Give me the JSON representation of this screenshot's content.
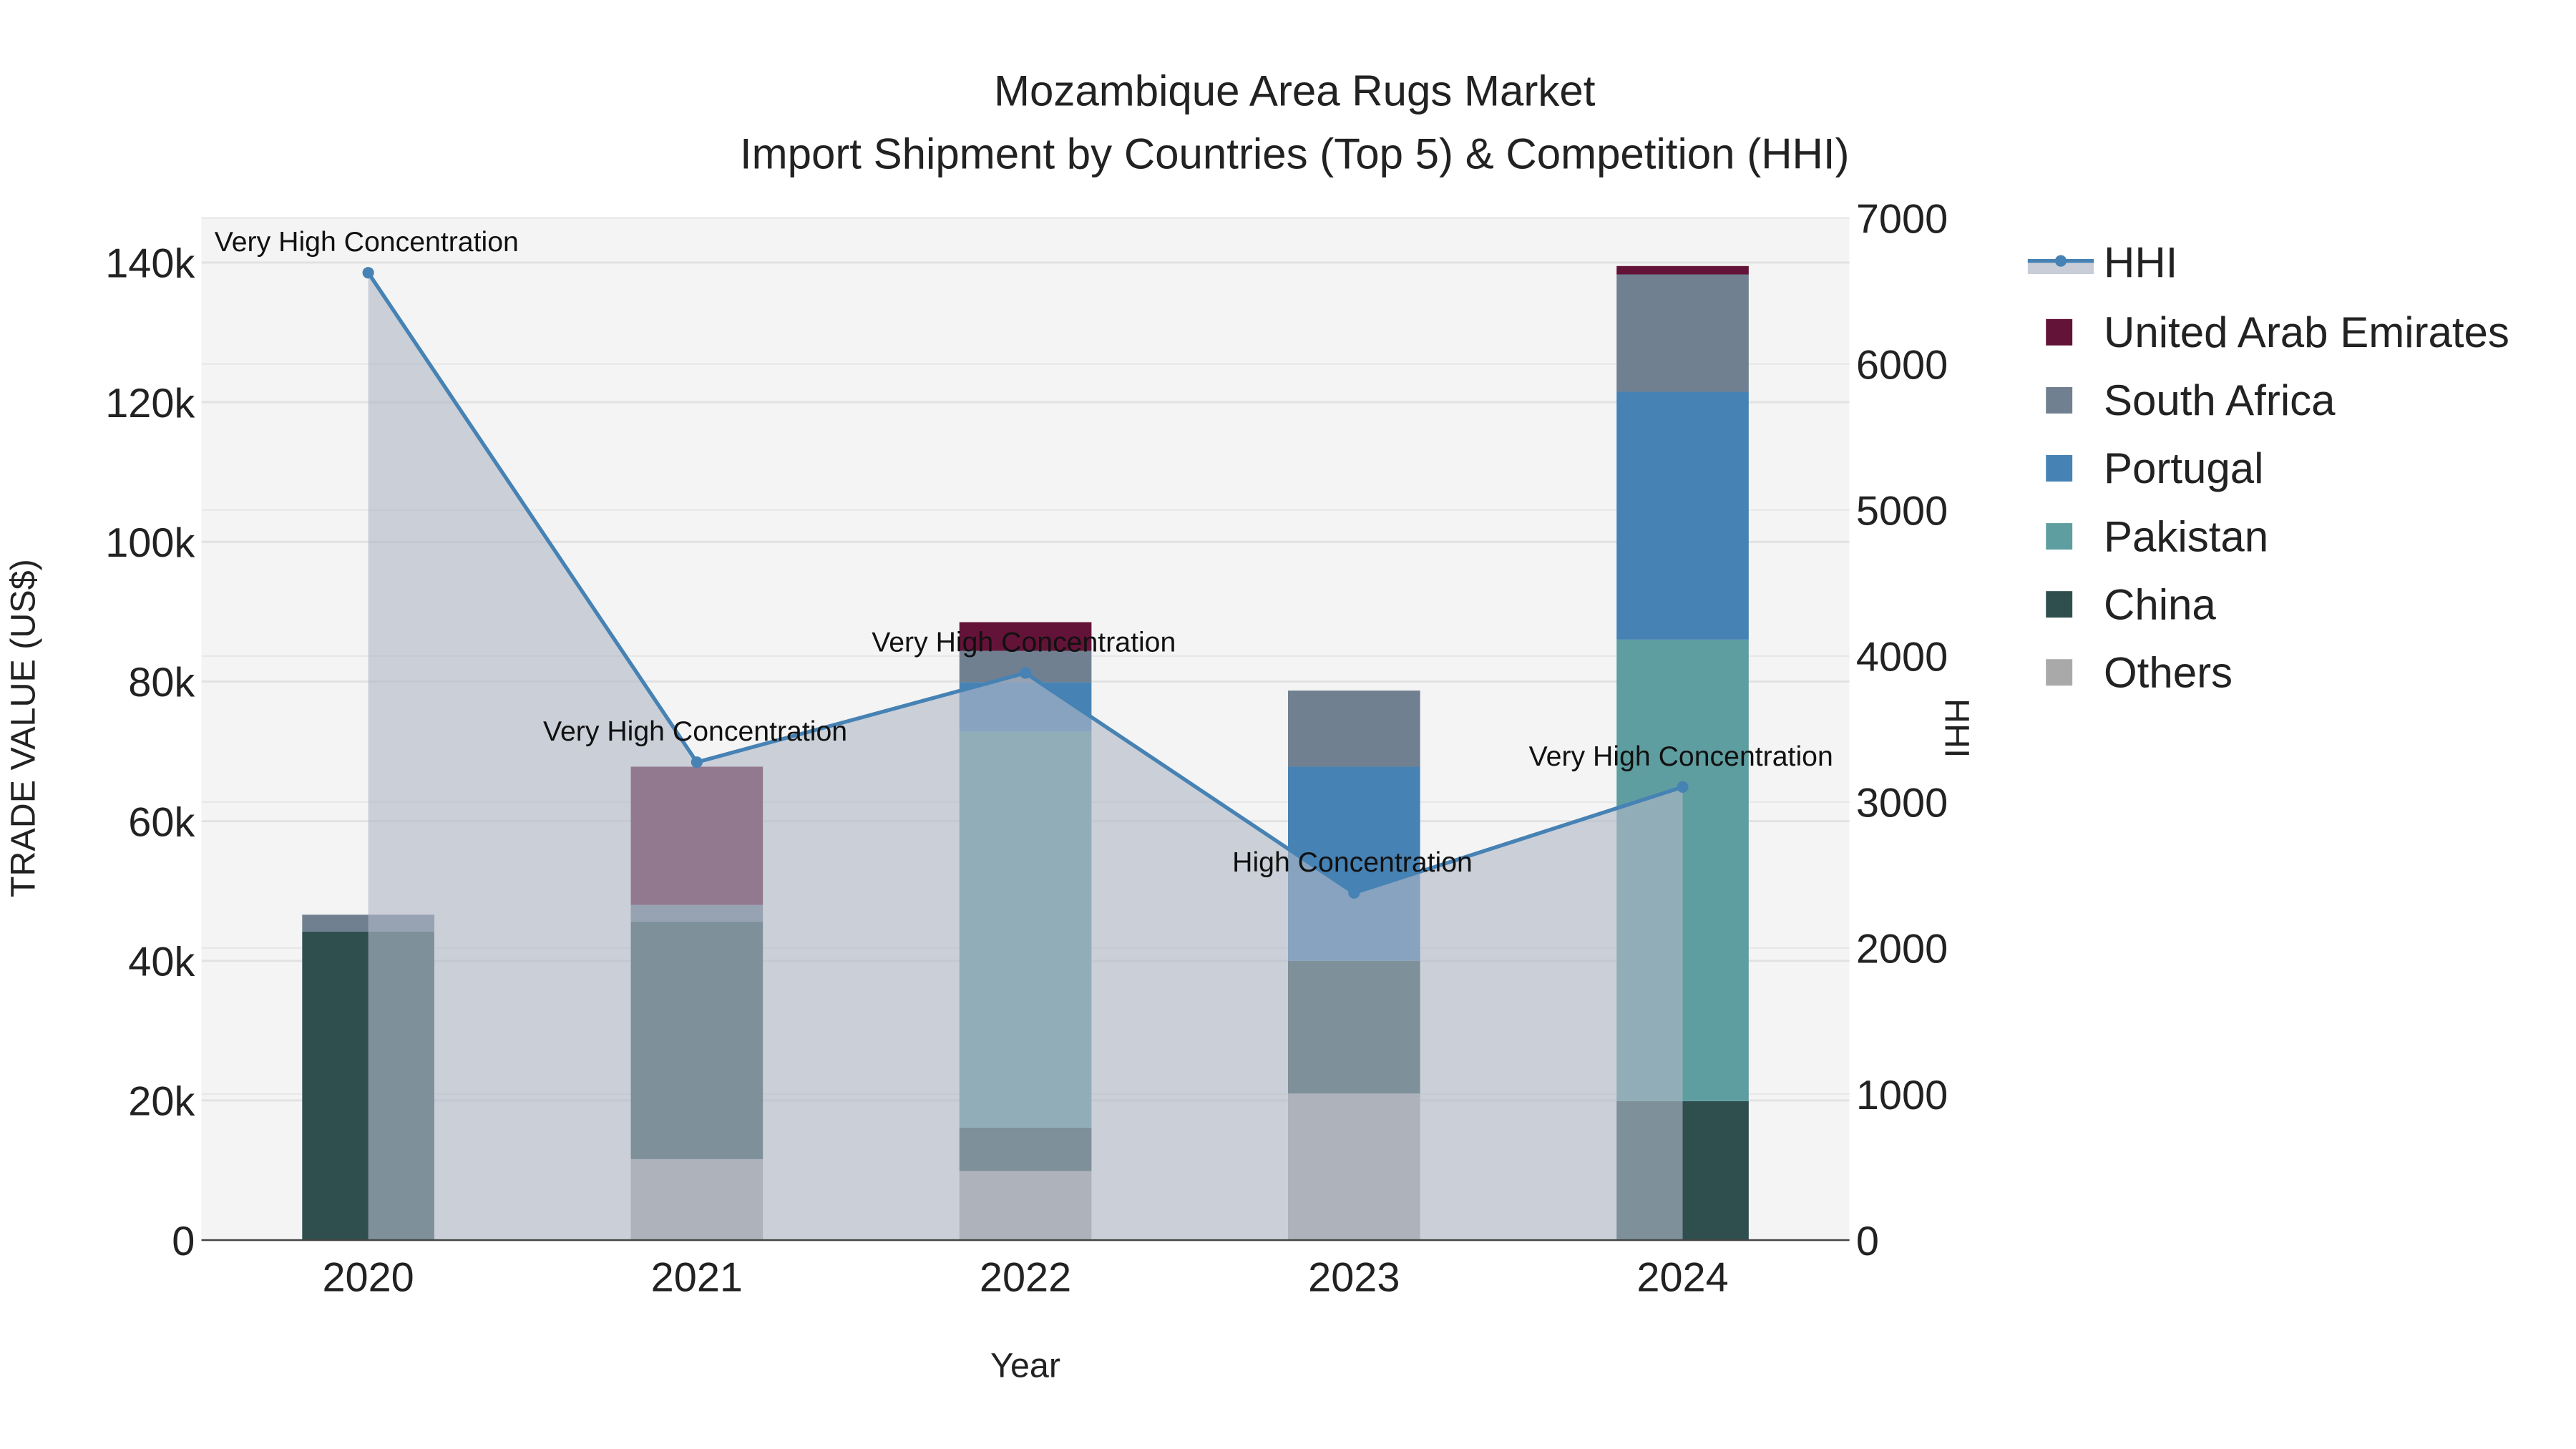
{
  "chart_data": {
    "type": "bar",
    "title": "Mozambique Area Rugs Market",
    "subtitle": "Import Shipment by Countries (Top 5) & Competition (HHI)",
    "xlabel": "Year",
    "ylabel": "TRADE VALUE (US$)",
    "y2label": "HHI",
    "categories": [
      "2020",
      "2021",
      "2022",
      "2023",
      "2024"
    ],
    "ylim": [
      0,
      146000
    ],
    "y2lim": [
      0,
      7000
    ],
    "yticks": [
      0,
      20000,
      40000,
      60000,
      80000,
      100000,
      120000,
      140000
    ],
    "ytick_labels": [
      "0",
      "20k",
      "40k",
      "60k",
      "80k",
      "100k",
      "120k",
      "140k"
    ],
    "y2ticks": [
      0,
      1000,
      2000,
      3000,
      4000,
      5000,
      6000,
      7000
    ],
    "y2tick_labels": [
      "0",
      "1000",
      "2000",
      "3000",
      "4000",
      "5000",
      "6000",
      "7000"
    ],
    "grid": true,
    "legend_position": "right",
    "series": [
      {
        "name": "Others",
        "color": "#A9A9A9",
        "values": [
          0,
          11600,
          9900,
          21000,
          0
        ]
      },
      {
        "name": "China",
        "color": "#2F4F4F",
        "values": [
          44200,
          34000,
          6200,
          19000,
          19900
        ]
      },
      {
        "name": "Pakistan",
        "color": "#5F9EA0",
        "values": [
          0,
          0,
          56700,
          0,
          66100
        ]
      },
      {
        "name": "Portugal",
        "color": "#4682B4",
        "values": [
          0,
          0,
          7100,
          27800,
          35500
        ]
      },
      {
        "name": "South Africa",
        "color": "#708090",
        "values": [
          2400,
          2400,
          4500,
          10900,
          16800
        ]
      },
      {
        "name": "United Arab Emirates",
        "color": "#641338",
        "values": [
          0,
          19800,
          4100,
          0,
          1200
        ]
      }
    ],
    "hhi": {
      "name": "HHI",
      "color": "#4682B4",
      "values": [
        6625,
        3273,
        3884,
        2378,
        3103
      ],
      "annotations": [
        "Very High Concentration",
        "Very High Concentration",
        "Very High Concentration",
        "High Concentration",
        "Very High Concentration"
      ]
    },
    "legend_order": [
      "HHI",
      "United Arab Emirates",
      "South Africa",
      "Portugal",
      "Pakistan",
      "China",
      "Others"
    ]
  }
}
